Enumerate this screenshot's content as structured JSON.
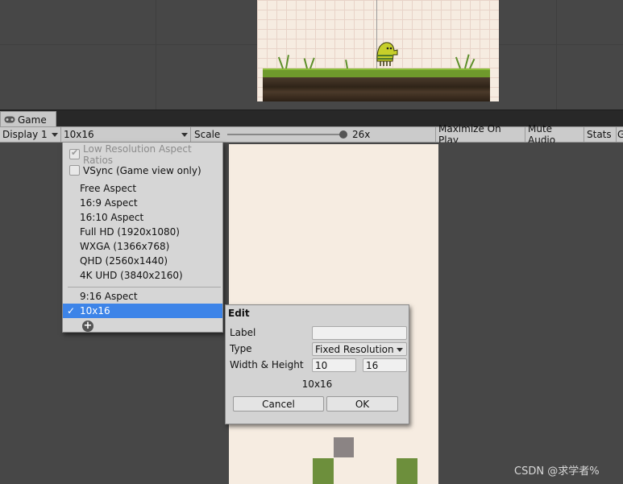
{
  "game_tab": {
    "label": "Game"
  },
  "toolbar": {
    "display": "Display 1",
    "aspect": "10x16",
    "scale_label": "Scale",
    "scale_value": "26x",
    "maximize": "Maximize On Play",
    "mute": "Mute Audio",
    "stats": "Stats",
    "gizmos": "G"
  },
  "dropdown": {
    "low_res": "Low Resolution Aspect Ratios",
    "vsync": "VSync (Game view only)",
    "items": [
      "Free Aspect",
      "16:9 Aspect",
      "16:10 Aspect",
      "Full HD (1920x1080)",
      "WXGA (1366x768)",
      "QHD (2560x1440)",
      "4K UHD (3840x2160)"
    ],
    "custom_items": [
      "9:16 Aspect",
      "10x16"
    ],
    "selected_check": "✓",
    "add_icon": "+"
  },
  "edit": {
    "title": "Edit",
    "label_label": "Label",
    "label_value": "",
    "type_label": "Type",
    "type_value": "Fixed Resolution",
    "wh_label": "Width & Height",
    "width": "10",
    "height": "16",
    "preview": "10x16",
    "cancel": "Cancel",
    "ok": "OK"
  },
  "watermark": "CSDN @求学者%",
  "colors": {
    "selection": "#3d84e8",
    "canvas_bg": "#f6ece1",
    "block_green": "#6d8f3c",
    "block_gray": "#8b8484"
  }
}
